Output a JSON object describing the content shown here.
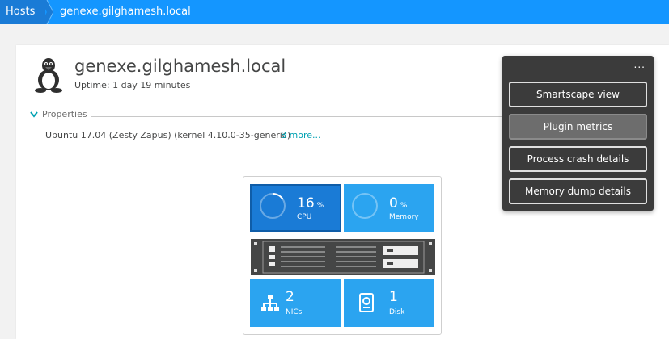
{
  "breadcrumb": {
    "root": "Hosts",
    "current": "genexe.gilghamesh.local"
  },
  "host": {
    "title": "genexe.gilghamesh.local",
    "uptime": "Uptime: 1 day 19 minutes",
    "os_icon": "linux-tux-icon"
  },
  "properties": {
    "toggle_label": "Properties",
    "summary": "Ubuntu 17.04 (Zesty Zapus) (kernel 4.10.0-35-generic)",
    "more_link": "8 more..."
  },
  "tiles": {
    "cpu": {
      "value": "16",
      "unit": "%",
      "label": "CPU",
      "fraction": 0.16
    },
    "memory": {
      "value": "0",
      "unit": "%",
      "label": "Memory",
      "fraction": 0
    },
    "nics": {
      "value": "2",
      "label": "NICs",
      "icon": "network-icon"
    },
    "disk": {
      "value": "1",
      "label": "Disk",
      "icon": "disk-icon"
    }
  },
  "menu": {
    "more_label": "...",
    "items": [
      {
        "label": "Smartscape view",
        "active": false
      },
      {
        "label": "Plugin metrics",
        "active": true
      },
      {
        "label": "Process crash details",
        "active": false
      },
      {
        "label": "Memory dump details",
        "active": false
      }
    ]
  },
  "colors": {
    "brand_blue": "#1496ff",
    "tile_blue": "#2ba4f0",
    "tile_selected": "#1a7bd6",
    "link_teal": "#00a1b2",
    "menu_bg": "#3b3b3b"
  }
}
